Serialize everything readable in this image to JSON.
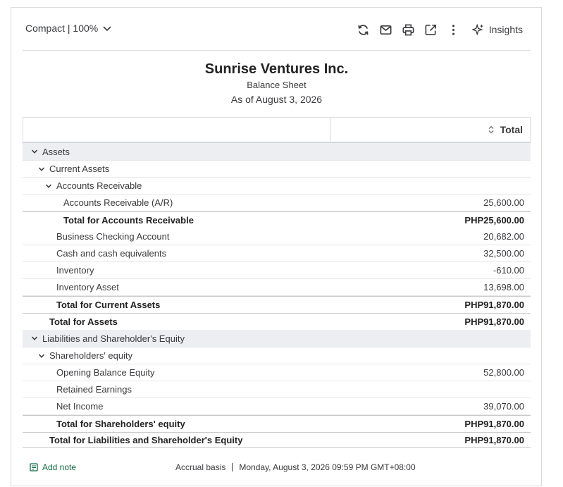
{
  "toolbar": {
    "view_label": "Compact | 100%",
    "insights_label": "Insights",
    "icons": [
      "refresh-icon",
      "email-icon",
      "print-icon",
      "export-icon",
      "more-vertical-icon",
      "insights-icon"
    ]
  },
  "report": {
    "company": "Sunrise Ventures Inc.",
    "name": "Balance Sheet",
    "date": "As of August 3, 2026"
  },
  "table": {
    "column_header": "Total",
    "rows": [
      {
        "label": "Assets",
        "amount": "",
        "level": 0,
        "type": "section"
      },
      {
        "label": "Current Assets",
        "amount": "",
        "level": 1,
        "type": "group"
      },
      {
        "label": "Accounts Receivable",
        "amount": "",
        "level": 2,
        "type": "group"
      },
      {
        "label": "Accounts Receivable (A/R)",
        "amount": "25,600.00",
        "level": 3,
        "type": "item"
      },
      {
        "label": "Total for Accounts Receivable",
        "amount": "PHP25,600.00",
        "level": 3,
        "type": "total"
      },
      {
        "label": "Business Checking Account",
        "amount": "20,682.00",
        "level": 2,
        "type": "item"
      },
      {
        "label": "Cash and cash equivalents",
        "amount": "32,500.00",
        "level": 2,
        "type": "item"
      },
      {
        "label": "Inventory",
        "amount": "-610.00",
        "level": 2,
        "type": "item"
      },
      {
        "label": "Inventory Asset",
        "amount": "13,698.00",
        "level": 2,
        "type": "item"
      },
      {
        "label": "Total for Current Assets",
        "amount": "PHP91,870.00",
        "level": 2,
        "type": "total"
      },
      {
        "label": "Total for Assets",
        "amount": "PHP91,870.00",
        "level": 1,
        "type": "total"
      },
      {
        "label": "Liabilities and Shareholder's Equity",
        "amount": "",
        "level": 0,
        "type": "section"
      },
      {
        "label": "Shareholders' equity",
        "amount": "",
        "level": 1,
        "type": "group"
      },
      {
        "label": "Opening Balance Equity",
        "amount": "52,800.00",
        "level": 2,
        "type": "item"
      },
      {
        "label": "Retained Earnings",
        "amount": "",
        "level": 2,
        "type": "item"
      },
      {
        "label": "Net Income",
        "amount": "39,070.00",
        "level": 2,
        "type": "item"
      },
      {
        "label": "Total for Shareholders' equity",
        "amount": "PHP91,870.00",
        "level": 2,
        "type": "total"
      },
      {
        "label": "Total for Liabilities and Shareholder's Equity",
        "amount": "PHP91,870.00",
        "level": 1,
        "type": "total-end"
      }
    ]
  },
  "footer": {
    "add_note": "Add note",
    "basis": "Accrual basis",
    "timestamp": "Monday, August 3, 2026 09:59 PM GMT+08:00"
  },
  "colors": {
    "section_bg": "#eceef1",
    "accent_green": "#0d6b46",
    "text": "#393a3d"
  }
}
